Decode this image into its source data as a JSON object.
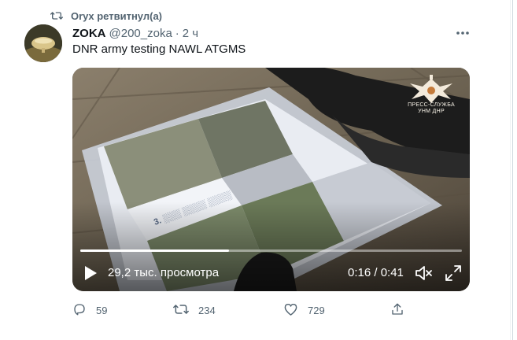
{
  "retweet": {
    "icon": "retweet-icon",
    "label": "Oryx ретвитнул(а)"
  },
  "tweet": {
    "author_name": "ZOKA",
    "author_handle": "@200_zoka",
    "separator": "·",
    "time": "2 ч",
    "text": "DNR army testing NAWL ATGMS"
  },
  "video": {
    "watermark_label": "ПРЕСС-СЛУЖБА УНМ ДНР",
    "views": "29,2 тыс. просмотра",
    "time": "0:16 / 0:41",
    "progress": 0.39
  },
  "actions": {
    "reply_count": "59",
    "retweet_count": "234",
    "like_count": "729"
  },
  "colors": {
    "text_secondary": "#536471",
    "text_primary": "#0f1419"
  }
}
